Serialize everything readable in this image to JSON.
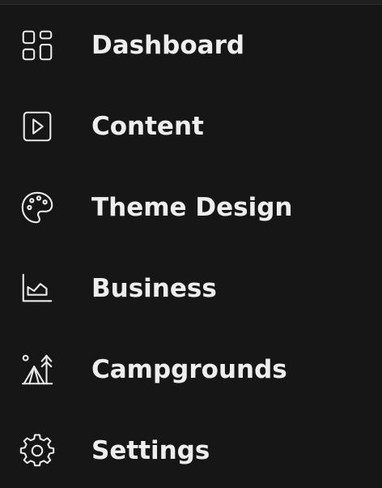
{
  "sidebar": {
    "items": [
      {
        "label": "Dashboard",
        "icon": "dashboard-icon"
      },
      {
        "label": "Content",
        "icon": "play-square-icon"
      },
      {
        "label": "Theme Design",
        "icon": "palette-icon"
      },
      {
        "label": "Business",
        "icon": "chart-icon"
      },
      {
        "label": "Campgrounds",
        "icon": "campground-icon"
      },
      {
        "label": "Settings",
        "icon": "gear-icon"
      }
    ]
  },
  "colors": {
    "background": "#161616",
    "text": "#eeeeee",
    "icon": "#e9e9e9"
  }
}
